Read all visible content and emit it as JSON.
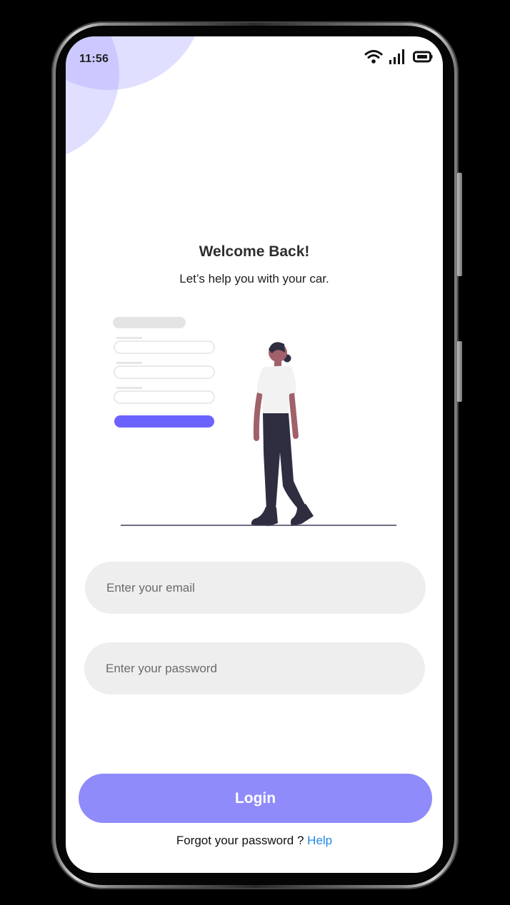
{
  "status_bar": {
    "time": "11:56",
    "icons": [
      "wifi-icon",
      "signal-icon",
      "battery-icon"
    ]
  },
  "welcome": {
    "title": "Welcome Back!",
    "subtitle": "Let’s help you with your car."
  },
  "form": {
    "email": {
      "value": "",
      "placeholder": "Enter your email"
    },
    "password": {
      "value": "",
      "placeholder": "Enter your password"
    },
    "login_label": "Login"
  },
  "footer": {
    "forgot_text": "Forgot your password ?",
    "help_label": "Help"
  },
  "colors": {
    "accent": "#8f8bfa",
    "illustration_accent": "#6c63ff",
    "link": "#1e88e5",
    "field_bg": "#eeeeee",
    "decor_circle": "#dcdaff"
  }
}
